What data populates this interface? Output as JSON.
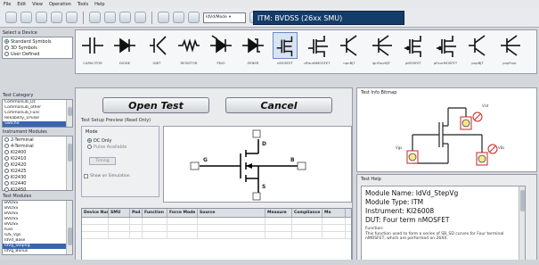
{
  "menu": [
    "File",
    "Edit",
    "View",
    "Operation",
    "Tools",
    "Help"
  ],
  "toolbar": {
    "select_value": "IdVd/Mode",
    "itm_label": "ITM: BVDSS (26xx SMU)"
  },
  "select_device": {
    "title": "Select a Device",
    "options": [
      "Standard Symbols",
      "3D Symbols",
      "User Defined"
    ],
    "selected_index": 0
  },
  "devices": [
    {
      "label": "CAPACITOR",
      "icon": "capacitor-icon"
    },
    {
      "label": "DIODE",
      "icon": "diode-icon"
    },
    {
      "label": "IGBT",
      "icon": "igbt-icon"
    },
    {
      "label": "RESISTOR",
      "icon": "resistor-icon"
    },
    {
      "label": "PDIO",
      "icon": "photodiode-icon"
    },
    {
      "label": "ZENER",
      "icon": "zener-icon"
    },
    {
      "label": "nMOSFET",
      "icon": "nmosfet-icon"
    },
    {
      "label": "dFourNMOSFET",
      "icon": "nmosfet4-icon"
    },
    {
      "label": "npnBJT",
      "icon": "npn-icon"
    },
    {
      "label": "lgnFourBJT",
      "icon": "npn4-icon"
    },
    {
      "label": "pMOSFET",
      "icon": "pmosfet-icon"
    },
    {
      "label": "pFourMOSFET",
      "icon": "pmosfet4-icon"
    },
    {
      "label": "pnpBJT",
      "icon": "pnp-icon"
    },
    {
      "label": "pnpFour",
      "icon": "pnp4-icon"
    }
  ],
  "selected_device_index": 6,
  "test_category": {
    "title": "Test Category",
    "items": [
      "CommonLib_Dc",
      "CommonLib_other",
      "CommonLib_Func",
      "Reliability_1Pulse",
      "Swtchd"
    ],
    "selected_index": 4
  },
  "instrument_modules": {
    "title": "Instrument Modules",
    "items": [
      "2-Terminal",
      "4-Terminal",
      "KI2400",
      "KI2410",
      "KI2420",
      "KI2425",
      "KI2430",
      "KI2440",
      "KI2450"
    ],
    "selected_index": -1
  },
  "test_modules": {
    "title": "Test Modules",
    "items": [
      "BVDSS",
      "BVDSS",
      "BVDSS",
      "BVDSS",
      "BVDSS",
      "IGss",
      "IDS_Vgs",
      "IdVd_Base",
      "IdVg_StepVg",
      "IdVg_Bonus"
    ],
    "selected_index": 8
  },
  "buttons": {
    "open_test": "Open Test",
    "cancel": "Cancel"
  },
  "preview": {
    "title": "Test Setup Preview (Read Only)",
    "mode_label": "Mode",
    "mode_options": [
      "DC Only",
      "Pulse Available"
    ],
    "timing_button": "Timing",
    "show_limit": "Show on Simulation",
    "terminals": [
      "D",
      "G",
      "B",
      "S"
    ]
  },
  "grid": {
    "headers": [
      "Device Num",
      "SMU",
      "Pad",
      "Function",
      "Force Mode",
      "Source",
      "Measure",
      "Compliance",
      "Ma"
    ],
    "rows": [
      [
        "",
        "",
        "",
        "",
        "",
        "",
        "",
        "",
        ""
      ],
      [
        "",
        "",
        "",
        "",
        "",
        "",
        "",
        "",
        ""
      ],
      [
        "",
        "",
        "",
        "",
        "",
        "",
        "",
        "",
        ""
      ]
    ]
  },
  "info_bitmap": {
    "title": "Test Info Bitmap",
    "labels": [
      "Vsd",
      "Vgs",
      "Vbs"
    ]
  },
  "test_help": {
    "title": "Test Help",
    "lines": [
      "Module Name: IdVd_StepVg",
      "Module Type: ITM",
      "Instrument: KI26008",
      "DUT: Four term nMOSFET"
    ],
    "function_label": "Function:",
    "description": "This function used to form a series of SB_SD curves for Four terminal nMOSFET, which are performed on 26XX."
  }
}
